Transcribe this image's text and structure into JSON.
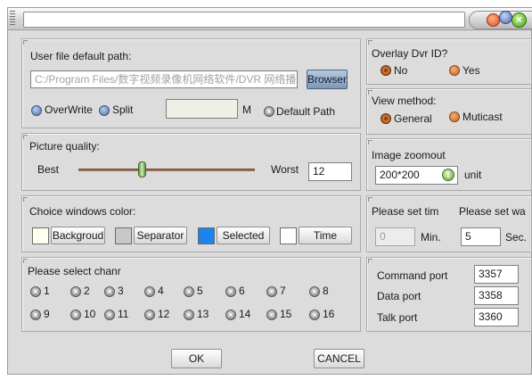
{
  "title_bar": {
    "title": "",
    "buttons": [
      "minimize-icon",
      "maximize-icon",
      "close-icon"
    ],
    "close_glyph": "×"
  },
  "file_path": {
    "label": "User file default path:",
    "value": "C:/Program Files/数字视频录像机网络软件/DVR 网络播",
    "browse_label": "Browser",
    "overwrite_label": "OverWrite",
    "split_label": "Split",
    "size_value": "",
    "size_unit": "M",
    "default_path_label": "Default Path"
  },
  "picture_quality": {
    "label": "Picture quality:",
    "best_label": "Best",
    "worst_label": "Worst",
    "value": "12",
    "slider_fraction": 0.36
  },
  "window_color": {
    "label": "Choice windows color:",
    "items": [
      {
        "label": "Backgroud",
        "swatch": "#fffff0"
      },
      {
        "label": "Separator",
        "swatch": "#c8c8c8"
      },
      {
        "label": "Selected",
        "swatch": "#1b84ee"
      },
      {
        "label": "Time",
        "swatch": "#ffffff"
      }
    ]
  },
  "channels": {
    "label": "Please select chanr",
    "items": [
      "1",
      "2",
      "3",
      "4",
      "5",
      "6",
      "7",
      "8",
      "9",
      "10",
      "11",
      "12",
      "13",
      "14",
      "15",
      "16"
    ],
    "check_glyph": "×"
  },
  "overlay": {
    "label": "Overlay Dvr ID?",
    "no_label": "No",
    "yes_label": "Yes"
  },
  "view_method": {
    "label": "View method:",
    "general_label": "General",
    "muticast_label": "Muticast"
  },
  "zoom": {
    "label": "Image zoomout",
    "value": "200*200",
    "spin_glyph": "⇕",
    "unit_label": "unit"
  },
  "time_settings": {
    "label_a": "Please set tim",
    "label_b": "Please set wa",
    "min_value": "0",
    "min_label": "Min.",
    "sec_value": "5",
    "sec_label": "Sec."
  },
  "ports": {
    "command_label": "Command port",
    "command_value": "3357",
    "data_label": "Data port",
    "data_value": "3358",
    "talk_label": "Talk port",
    "talk_value": "3360"
  },
  "dialog_buttons": {
    "ok_label": "OK",
    "cancel_label": "CANCEL"
  }
}
